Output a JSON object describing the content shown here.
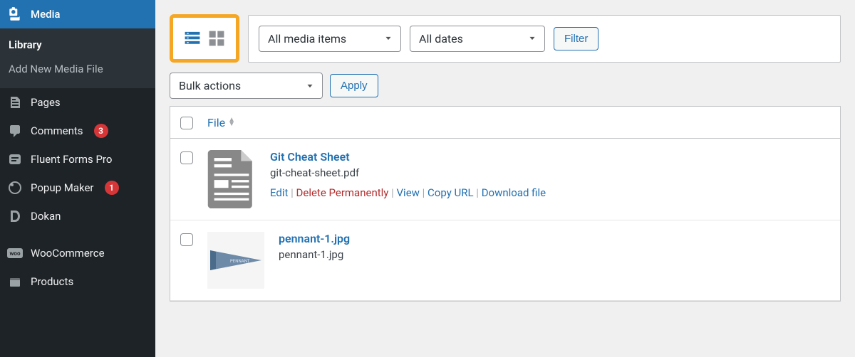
{
  "sidebar": {
    "media_label": "Media",
    "library_label": "Library",
    "add_new_label": "Add New Media File",
    "pages_label": "Pages",
    "comments_label": "Comments",
    "comments_count": "3",
    "fluent_label": "Fluent Forms Pro",
    "popup_label": "Popup Maker",
    "popup_count": "1",
    "dokan_label": "Dokan",
    "woo_label": "WooCommerce",
    "products_label": "Products"
  },
  "filters": {
    "media_items": "All media items",
    "dates": "All dates",
    "filter_btn": "Filter"
  },
  "bulk": {
    "bulk_label": "Bulk actions",
    "apply_label": "Apply"
  },
  "table": {
    "file_col": "File",
    "rows": [
      {
        "title": "Git Cheat Sheet",
        "filename": "git-cheat-sheet.pdf"
      },
      {
        "title": "pennant-1.jpg",
        "filename": "pennant-1.jpg"
      }
    ],
    "actions": {
      "edit": "Edit",
      "delete": "Delete Permanently",
      "view": "View",
      "copy": "Copy URL",
      "download": "Download file"
    }
  }
}
